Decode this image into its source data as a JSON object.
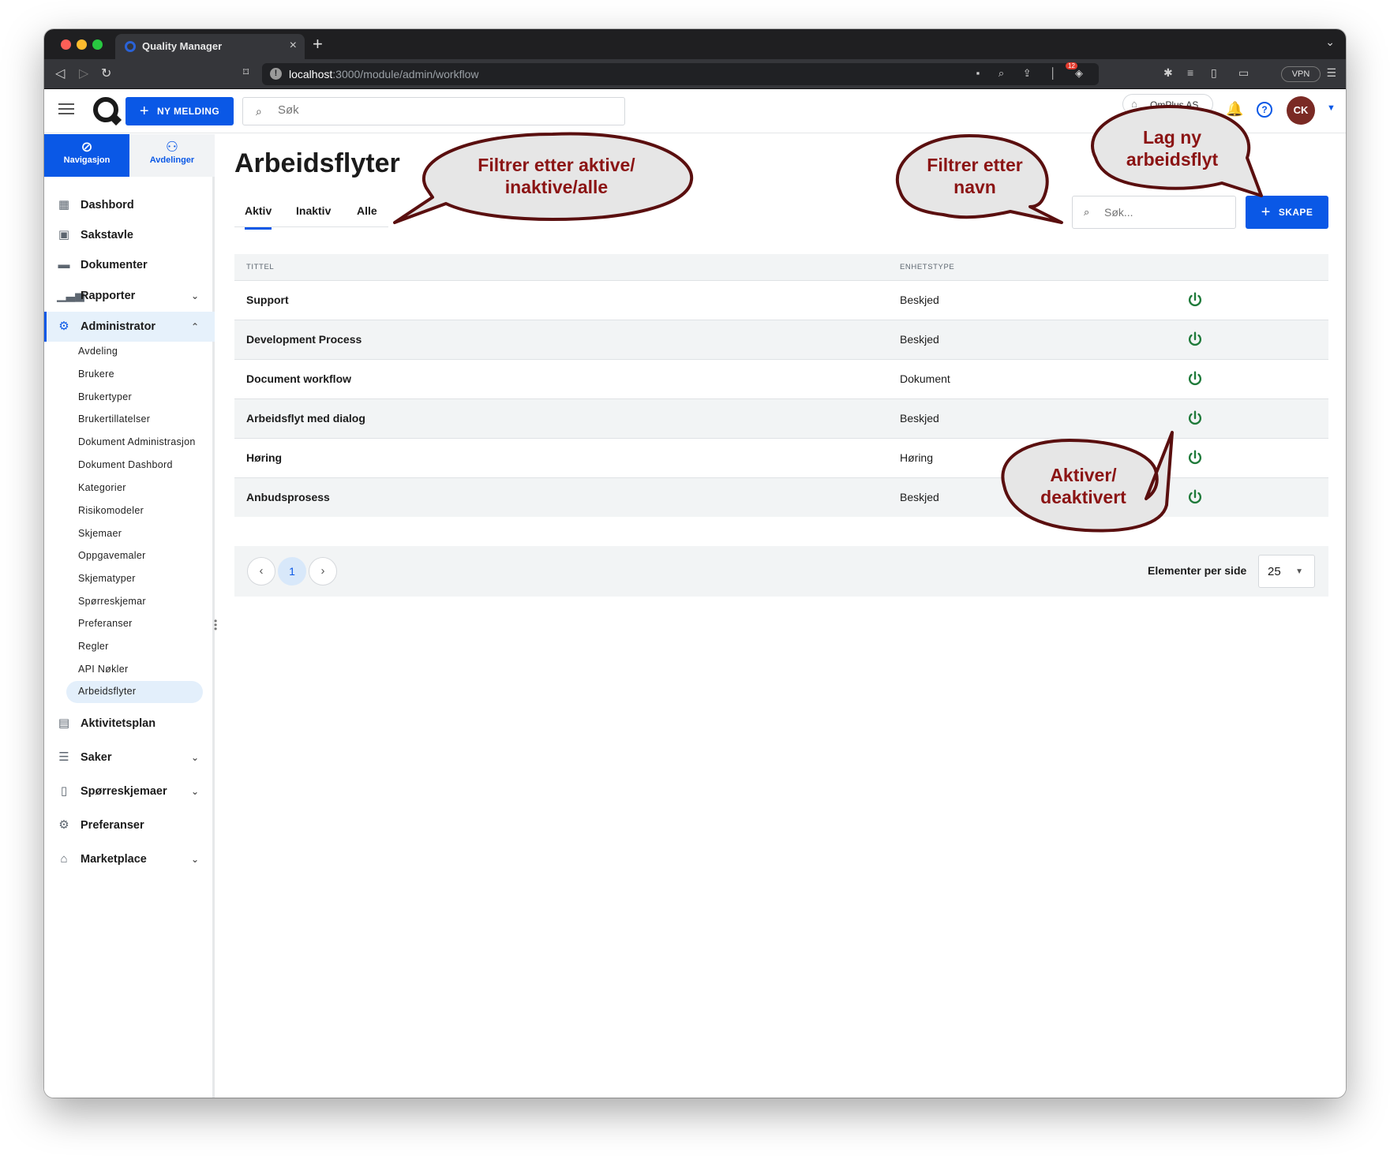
{
  "browser": {
    "tab_title": "Quality Manager",
    "url_host": "localhost",
    "url_path": ":3000/module/admin/workflow",
    "brave_badge": "12",
    "vpn_label": "VPN"
  },
  "appbar": {
    "new_message_label": "NY MELDING",
    "search_placeholder": "Søk",
    "org_name": "QmPlus AS",
    "avatar_initials": "CK",
    "accent_color": "#0a58e6"
  },
  "sidebar": {
    "tabs": [
      {
        "label": "Navigasjon",
        "icon": "compass-icon",
        "active": true
      },
      {
        "label": "Avdelinger",
        "icon": "org-chart-icon",
        "active": false
      }
    ],
    "items": [
      {
        "label": "Dashbord",
        "icon": "dashboard-icon"
      },
      {
        "label": "Sakstavle",
        "icon": "board-icon"
      },
      {
        "label": "Dokumenter",
        "icon": "folder-icon"
      },
      {
        "label": "Rapporter",
        "icon": "bar-chart-icon",
        "expandable": true
      },
      {
        "label": "Administrator",
        "icon": "admin-gear-icon",
        "expandable": true,
        "expanded": true,
        "active": true
      },
      {
        "label": "Aktivitetsplan",
        "icon": "calendar-icon"
      },
      {
        "label": "Saker",
        "icon": "cases-icon",
        "expandable": true
      },
      {
        "label": "Spørreskjemaer",
        "icon": "clipboard-icon",
        "expandable": true
      },
      {
        "label": "Preferanser",
        "icon": "gear-icon"
      },
      {
        "label": "Marketplace",
        "icon": "store-icon",
        "expandable": true
      }
    ],
    "admin_subitems": [
      "Avdeling",
      "Brukere",
      "Brukertyper",
      "Brukertillatelser",
      "Dokument Administrasjon",
      "Dokument Dashbord",
      "Kategorier",
      "Risikomodeler",
      "Skjemaer",
      "Oppgavemaler",
      "Skjematyper",
      "Spørreskjemar",
      "Preferanser",
      "Regler",
      "API Nøkler",
      "Arbeidsflyter"
    ],
    "active_subitem": "Arbeidsflyter"
  },
  "main": {
    "title": "Arbeidsflyter",
    "filter_tabs": [
      {
        "label": "Aktiv",
        "active": true
      },
      {
        "label": "Inaktiv",
        "active": false
      },
      {
        "label": "Alle",
        "active": false
      }
    ],
    "search_placeholder": "Søk...",
    "create_label": "SKAPE",
    "columns": [
      "TITTEL",
      "ENHETSTYPE"
    ],
    "rows": [
      {
        "title": "Support",
        "type": "Beskjed",
        "active": true
      },
      {
        "title": "Development Process",
        "type": "Beskjed",
        "active": true
      },
      {
        "title": "Document workflow",
        "type": "Dokument",
        "active": true
      },
      {
        "title": "Arbeidsflyt med dialog",
        "type": "Beskjed",
        "active": true
      },
      {
        "title": "Høring",
        "type": "Høring",
        "active": true
      },
      {
        "title": "Anbudsprosess",
        "type": "Beskjed",
        "active": true
      }
    ],
    "power_color": "#1f7a3a",
    "pagination": {
      "current_page": "1",
      "per_page_label": "Elementer per side",
      "per_page_value": "25"
    }
  },
  "callouts": {
    "filter_tabs": "Filtrer etter aktive/ inaktive/alle",
    "filter_name": "Filtrer etter navn",
    "create_new": "Lag ny arbeidsflyt",
    "toggle": "Aktiver/ deaktivert",
    "fill_color": "#e6e6e6",
    "border_color": "#5a0f0f",
    "text_color": "#8b1414"
  }
}
